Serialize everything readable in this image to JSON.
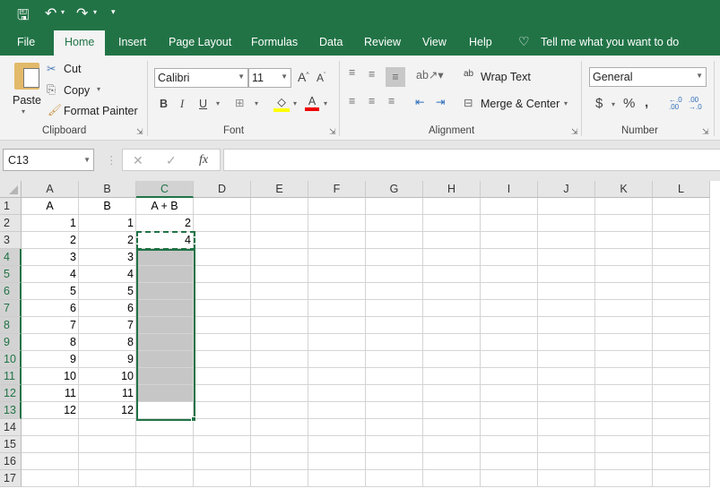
{
  "qat": {
    "save": "save-icon",
    "undo": "undo-icon",
    "redo": "redo-icon",
    "customize": "▾"
  },
  "tabs": [
    "File",
    "Home",
    "Insert",
    "Page Layout",
    "Formulas",
    "Data",
    "Review",
    "View",
    "Help"
  ],
  "tell_me": "Tell me what you want to do",
  "clipboard": {
    "paste": "Paste",
    "cut": "Cut",
    "copy": "Copy",
    "format_painter": "Format Painter",
    "group": "Clipboard"
  },
  "font": {
    "name": "Calibri",
    "size": "11",
    "bold": "B",
    "italic": "I",
    "underline": "U",
    "group": "Font"
  },
  "alignment": {
    "wrap": "Wrap Text",
    "merge": "Merge & Center",
    "group": "Alignment"
  },
  "number": {
    "format": "General",
    "currency": "$",
    "percent": "%",
    "comma": ",",
    "inc": "←.0 .00",
    "dec": ".00 →.0",
    "group": "Number"
  },
  "formula_bar": {
    "name_box": "C13",
    "cancel": "✕",
    "enter": "✓",
    "fx": "fx",
    "value": ""
  },
  "columns": [
    "A",
    "B",
    "C",
    "D",
    "E",
    "F",
    "G",
    "H",
    "I",
    "J",
    "K",
    "L"
  ],
  "rows": [
    [
      "A",
      "B",
      "A + B"
    ],
    [
      "1",
      "1",
      "2"
    ],
    [
      "2",
      "2",
      "4"
    ],
    [
      "3",
      "3",
      ""
    ],
    [
      "4",
      "4",
      ""
    ],
    [
      "5",
      "5",
      ""
    ],
    [
      "6",
      "6",
      ""
    ],
    [
      "7",
      "7",
      ""
    ],
    [
      "8",
      "8",
      ""
    ],
    [
      "9",
      "9",
      ""
    ],
    [
      "10",
      "10",
      ""
    ],
    [
      "11",
      "11",
      ""
    ],
    [
      "12",
      "12",
      ""
    ],
    [
      "",
      "",
      ""
    ],
    [
      "",
      "",
      ""
    ],
    [
      "",
      "",
      ""
    ],
    [
      "",
      "",
      ""
    ]
  ],
  "colors": {
    "accent": "#217346"
  }
}
